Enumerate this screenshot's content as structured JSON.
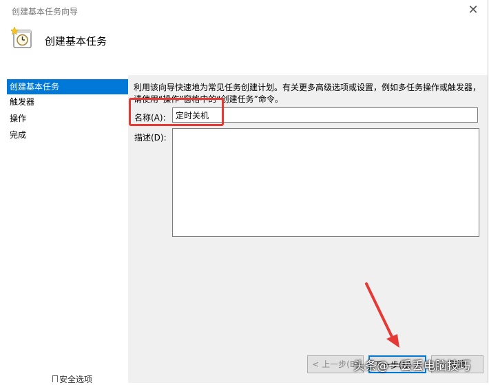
{
  "window": {
    "title": "创建基本任务向导",
    "close_glyph": "✕"
  },
  "header": {
    "icon": "clock-task-icon",
    "title": "创建基本任务"
  },
  "nav": {
    "items": [
      {
        "label": "创建基本任务",
        "active": true
      },
      {
        "label": "触发器",
        "active": false
      },
      {
        "label": "操作",
        "active": false
      },
      {
        "label": "完成",
        "active": false
      }
    ]
  },
  "main": {
    "description": "利用该向导快速地为常见任务创建计划。有关更多高级选项或设置，例如多任务操作或触发器，请使用“操作”窗格中的“创建任务”命令。",
    "name_label": "名称(A):",
    "name_value": "定时关机",
    "desc_label": "描述(D):"
  },
  "buttons": {
    "back": "< 上一步(B)",
    "next": "下一步(N) >",
    "cancel": "取消"
  },
  "annotations": {
    "highlight_color": "#e53935",
    "watermark": "头条@一丢丢电脑技巧"
  },
  "background": {
    "partial_text": "安全选项"
  },
  "colors": {
    "accent": "#0078d7",
    "pane": "#f0f0f0"
  }
}
